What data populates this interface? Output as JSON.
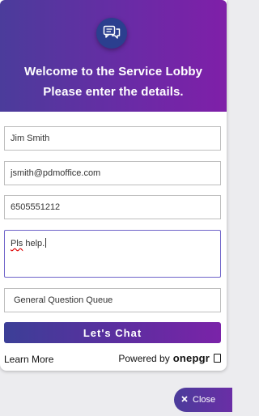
{
  "header": {
    "line1": "Welcome to the Service Lobby",
    "line2": "Please enter the details.",
    "icon": "chat-bubbles-icon"
  },
  "form": {
    "name_value": "Jim Smith",
    "email_value": "jsmith@pdmoffice.com",
    "phone_value": "6505551212",
    "message_typo": "Pls",
    "message_rest": " help.",
    "queue_selected": "General Question Queue",
    "submit_label": "Let's Chat"
  },
  "footer": {
    "learn_more": "Learn More",
    "powered_by": "Powered by",
    "brand": "onepgr"
  },
  "close": {
    "label": "Close",
    "icon": "close-x-icon"
  },
  "colors": {
    "accent_start": "#4b3c9b",
    "accent_end": "#7f1fa8",
    "badge": "#2b3f8f"
  }
}
